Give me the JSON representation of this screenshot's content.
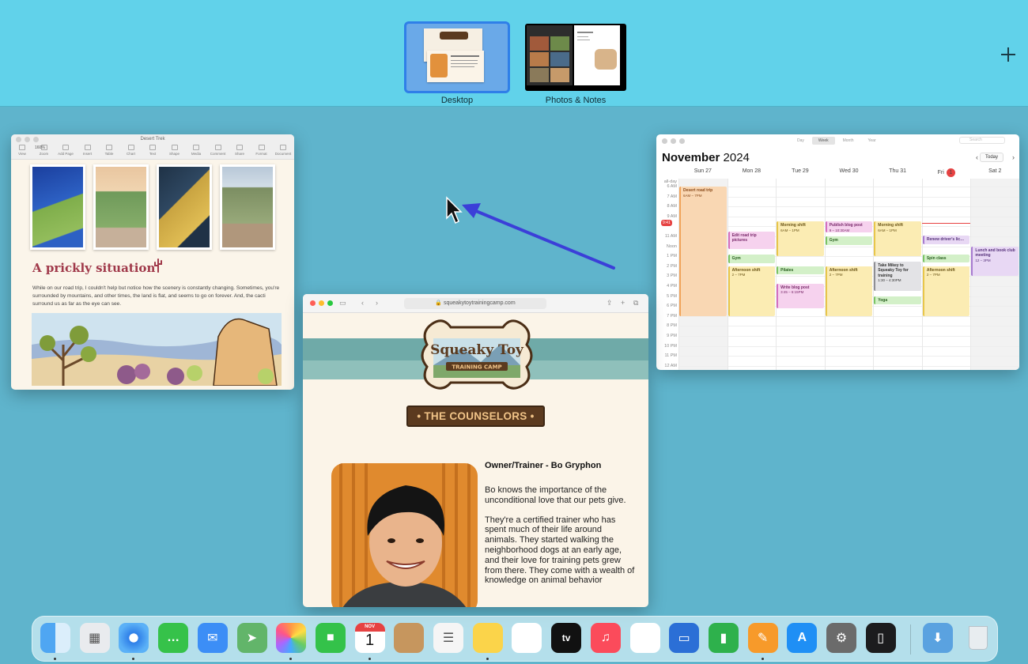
{
  "mission_control": {
    "spaces": [
      {
        "label": "Desktop",
        "active": true
      },
      {
        "label": "Photos & Notes",
        "active": false
      }
    ],
    "add_space_icon": "plus-icon"
  },
  "pages_window": {
    "title": "Desert Trek",
    "toolbar": [
      "View",
      "Zoom",
      "Add Page",
      "Insert",
      "Table",
      "Chart",
      "Text",
      "Shape",
      "Media",
      "Comment",
      "Share",
      "Format",
      "Document"
    ],
    "zoom": "160%",
    "heading": "A prickly situation",
    "body": "While on our road trip, I couldn't help but notice how the scenery is constantly changing. Sometimes, you're surrounded by mountains, and other times, the land is flat, and seems to go on forever. And, the cacti surround us as far as the eye can see."
  },
  "calendar_window": {
    "view_tabs": [
      "Day",
      "Week",
      "Month",
      "Year"
    ],
    "active_view": "Week",
    "search_placeholder": "Search",
    "month": "November",
    "year": "2024",
    "today_label": "Today",
    "all_day_label": "all-day",
    "now_time": "9:41",
    "days": [
      "Sun 27",
      "Mon 28",
      "Tue 29",
      "Wed 30",
      "Thu 31",
      "Fri",
      "Sat 2"
    ],
    "today_date": "1",
    "hours": [
      "6 AM",
      "7 AM",
      "8 AM",
      "9 AM",
      "",
      "11 AM",
      "Noon",
      "1 PM",
      "2 PM",
      "3 PM",
      "4 PM",
      "5 PM",
      "6 PM",
      "7 PM",
      "8 PM",
      "9 PM",
      "10 PM",
      "11 PM",
      "12 AM"
    ],
    "events": [
      {
        "title": "Desert road trip",
        "time": "6AM – 7PM"
      },
      {
        "title": "Edit road trip pictures",
        "time": ""
      },
      {
        "title": "Gym",
        "time": ""
      },
      {
        "title": "Afternoon shift",
        "time": "2 – 7PM"
      },
      {
        "title": "Morning shift",
        "time": "6AM – 1PM"
      },
      {
        "title": "Pilates",
        "time": ""
      },
      {
        "title": "Write blog post",
        "time": "3:45 – 6:15PM"
      },
      {
        "title": "Publish blog post",
        "time": "9 – 10:30AM"
      },
      {
        "title": "Gym",
        "time": ""
      },
      {
        "title": "Afternoon shift",
        "time": "2 – 7PM"
      },
      {
        "title": "Morning shift",
        "time": "6AM – 1PM"
      },
      {
        "title": "Take Mikey to Squeaky Toy for training",
        "time": "1:30 – 4:30PM"
      },
      {
        "title": "Yoga",
        "time": ""
      },
      {
        "title": "Renew driver's lic…",
        "time": ""
      },
      {
        "title": "Spin class",
        "time": ""
      },
      {
        "title": "Afternoon shift",
        "time": "2 – 7PM"
      },
      {
        "title": "Lunch and book club meeting",
        "time": "12 – 3PM"
      }
    ]
  },
  "safari_window": {
    "url": "squeakytoytrainingcamp.com",
    "logo_title": "Squeaky Toy",
    "logo_sub": "TRAINING CAMP",
    "section_banner": "• THE COUNSELORS •",
    "person_title": "Owner/Trainer - Bo Gryphon",
    "bio_paragraphs": [
      "Bo knows the importance of the unconditional love that our pets give.",
      "They're a certified trainer who has spent much of their life around animals. They started walking the neighborhood dogs at an early age, and their love for training pets grew from there. They come with a wealth of knowledge on animal behavior"
    ]
  },
  "dock": {
    "apps": [
      "Finder",
      "Launchpad",
      "Safari",
      "Messages",
      "Mail",
      "Maps",
      "Photos",
      "FaceTime",
      "Calendar",
      "Contacts",
      "Reminders",
      "Notes",
      "Freeform",
      "TV",
      "Music",
      "News",
      "Keynote",
      "Numbers",
      "Pages",
      "App Store",
      "System Settings",
      "iPhone Mirroring",
      "Downloads",
      "Trash"
    ],
    "calendar_month": "NOV",
    "calendar_day": "1",
    "tv_label": "tv"
  },
  "colors": {
    "desktop": "#5fb4cc",
    "spacebar": "#61d2ea",
    "accent": "#2f7fe8",
    "annotation_arrow": "#3b3fd8"
  }
}
